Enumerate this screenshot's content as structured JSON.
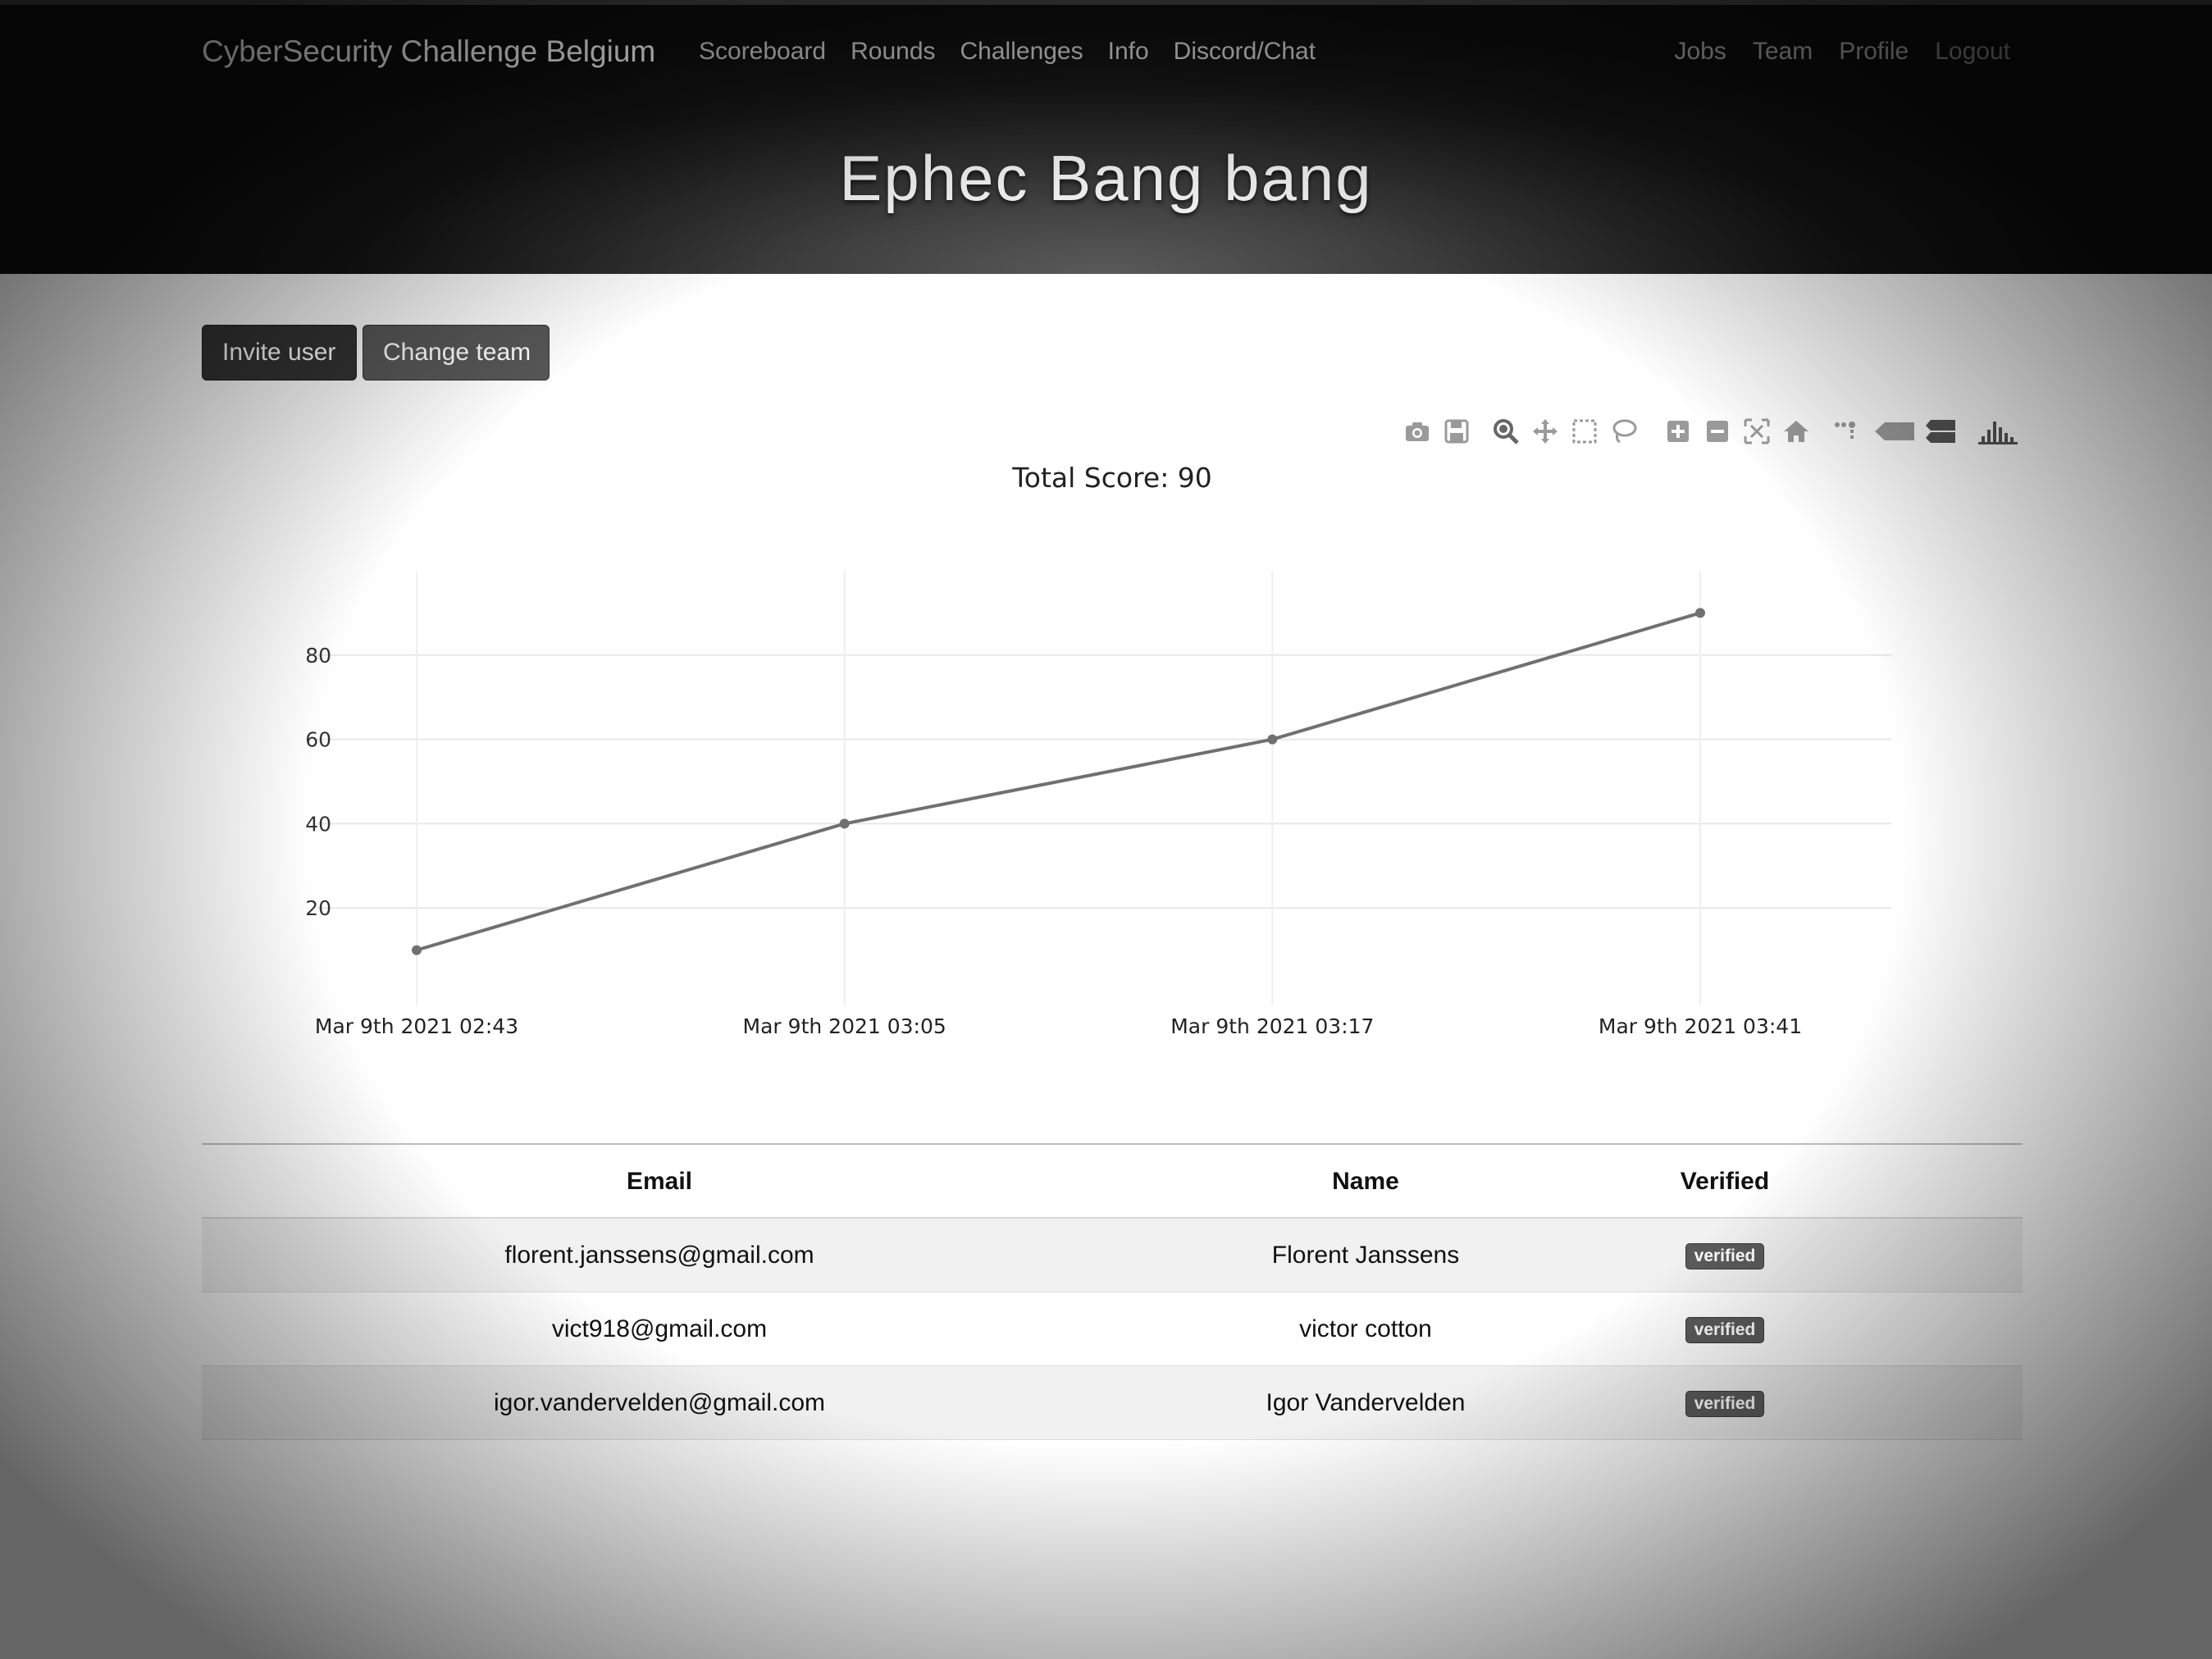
{
  "navbar": {
    "brand": "CyberSecurity Challenge Belgium",
    "left_links": [
      "Scoreboard",
      "Rounds",
      "Challenges",
      "Info",
      "Discord/Chat"
    ],
    "right_links": [
      "Jobs",
      "Team",
      "Profile",
      "Logout"
    ]
  },
  "page": {
    "title": "Ephec Bang bang"
  },
  "actions": {
    "invite_label": "Invite user",
    "change_team_label": "Change team"
  },
  "modebar": {
    "icons": [
      "camera-icon",
      "save-icon",
      "zoom-icon",
      "pan-icon",
      "box-select-icon",
      "lasso-select-icon",
      "zoom-in-icon",
      "zoom-out-icon",
      "autoscale-icon",
      "reset-axes-icon",
      "toggle-spike-lines-icon",
      "hover-closest-icon",
      "hover-compare-icon",
      "plotly-logo-icon"
    ]
  },
  "chart_data": {
    "type": "line",
    "title": "Total Score: 90",
    "x": [
      "Mar 9th 2021 02:43",
      "Mar 9th 2021 03:05",
      "Mar 9th 2021 03:17",
      "Mar 9th 2021 03:41"
    ],
    "series": [
      {
        "values": [
          10,
          40,
          60,
          90
        ]
      }
    ],
    "yticks": [
      20,
      40,
      60,
      80
    ],
    "ylim": [
      0,
      100
    ],
    "grid": true,
    "color": "#707070"
  },
  "team_table": {
    "headers": {
      "email": "Email",
      "name": "Name",
      "verified": "Verified"
    },
    "rows": [
      {
        "email": "florent.janssens@gmail.com",
        "name": "Florent Janssens",
        "verified": "verified"
      },
      {
        "email": "vict918@gmail.com",
        "name": "victor cotton",
        "verified": "verified"
      },
      {
        "email": "igor.vandervelden@gmail.com",
        "name": "Igor Vandervelden",
        "verified": "verified"
      }
    ]
  }
}
